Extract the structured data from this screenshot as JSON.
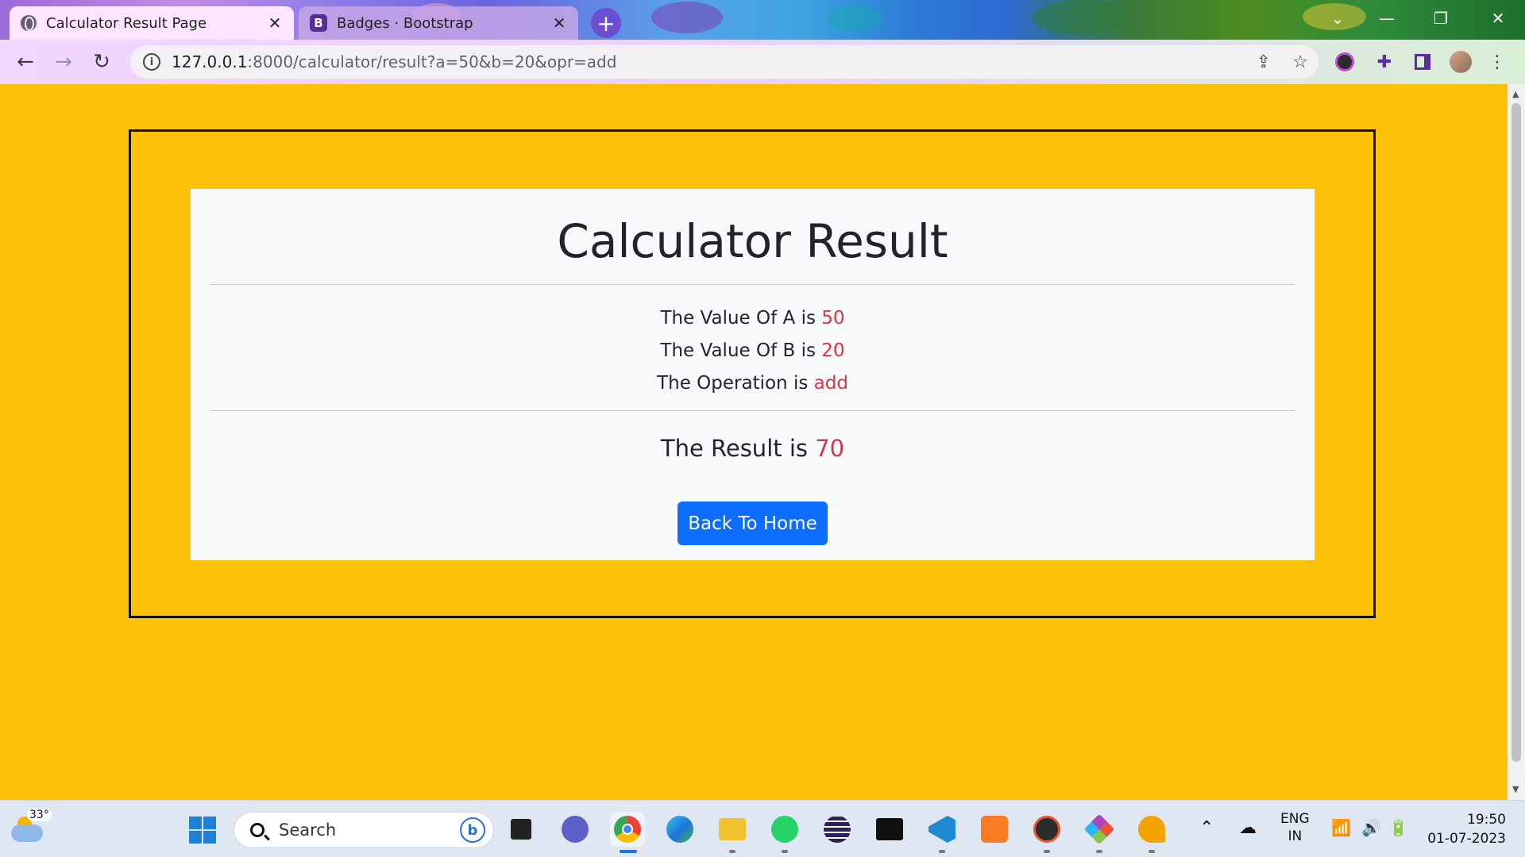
{
  "browser": {
    "tabs": [
      {
        "label": "Calculator Result Page",
        "active": true
      },
      {
        "label": "Badges · Bootstrap",
        "active": false
      }
    ],
    "url_host": "127.0.0.1",
    "url_path": ":8000/calculator/result?a=50&b=20&opr=add"
  },
  "page": {
    "title": "Calculator Result",
    "value_a_label": "The Value Of A is",
    "value_a": "50",
    "value_b_label": "The Value Of B is",
    "value_b": "20",
    "operation_label": "The Operation is",
    "operation": "add",
    "result_label": "The Result is",
    "result": "70",
    "back_button": "Back To Home"
  },
  "taskbar": {
    "weather_temp": "33°",
    "search_placeholder": "Search",
    "language": "ENG",
    "region": "IN",
    "time": "19:50",
    "date": "01-07-2023"
  },
  "colors": {
    "page_background": "#ffc107",
    "accent_red": "#dc3545",
    "button_blue": "#0d6efd"
  }
}
